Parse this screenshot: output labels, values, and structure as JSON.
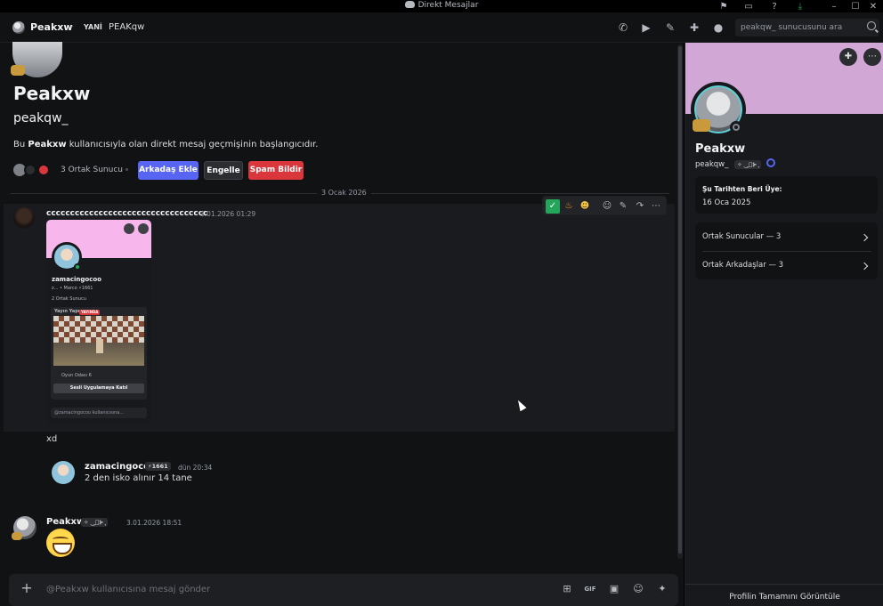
{
  "window": {
    "title": "Direkt Mesajlar"
  },
  "header": {
    "name": "Peakxw",
    "tag": "YANİ",
    "subtitle": "PEAKqw",
    "search_placeholder": "peakqw_ sunucusunu ara"
  },
  "profile_intro": {
    "display_name": "Peakxw",
    "username": "peakqw_",
    "desc_before": "Bu ",
    "desc_bold": "Peakxw",
    "desc_after": " kullanıcısıyla olan direkt mesaj geçmişinin başlangıcıdır.",
    "mutual_servers": "3 Ortak Sunucu",
    "add_friend": "Arkadaş Ekle",
    "block": "Engelle",
    "report_spam": "Spam Bildir"
  },
  "date_divider": "3 Ocak 2026",
  "messages": [
    {
      "author": "cccccccccccccccccccccccccccccccccc",
      "timestamp": "3.01.2026 01:29",
      "embed": {
        "name": "zamacingocoo",
        "line1": "z... • Marco",
        "badge": "1661",
        "mutual": "2 Ortak Sunucu",
        "activity": "Yayın Yapıyor",
        "live": "YAYINDA",
        "voice": "Oyun Odası 6",
        "join_button": "Sesli Uygulamaya Katıl",
        "message_placeholder": "@zamacingocoo kullanıcısına..."
      },
      "text": "xd"
    },
    {
      "author": "zamacingocoo",
      "badge": "1661",
      "timestamp": "dün 20:34",
      "text": "2 den isko alınır 14 tane"
    },
    {
      "author": "Peakxw",
      "badge": "✧ ‿̩͙⊱ ̩͙",
      "timestamp": "3.01.2026 18:51"
    }
  ],
  "composer": {
    "placeholder": "@Peakxw kullanıcısına mesaj gönder"
  },
  "side_panel": {
    "display_name": "Peakxw",
    "username": "peakqw_",
    "user_badge": "✧ ‿̩͙⊱ ̩͙",
    "member_since_label": "Şu Tarihten Beri Üye:",
    "member_since_value": "16 Oca 2025",
    "mutual_servers": "Ortak Sunucular — 3",
    "mutual_friends": "Ortak Arkadaşlar — 3",
    "view_full_profile": "Profilin Tamamını Görüntüle"
  },
  "colors": {
    "blurple": "#5865f2",
    "danger": "#da373c",
    "side_banner": "#d1a7d6",
    "embed_banner": "#f7b7ec",
    "online": "#23a55a"
  }
}
